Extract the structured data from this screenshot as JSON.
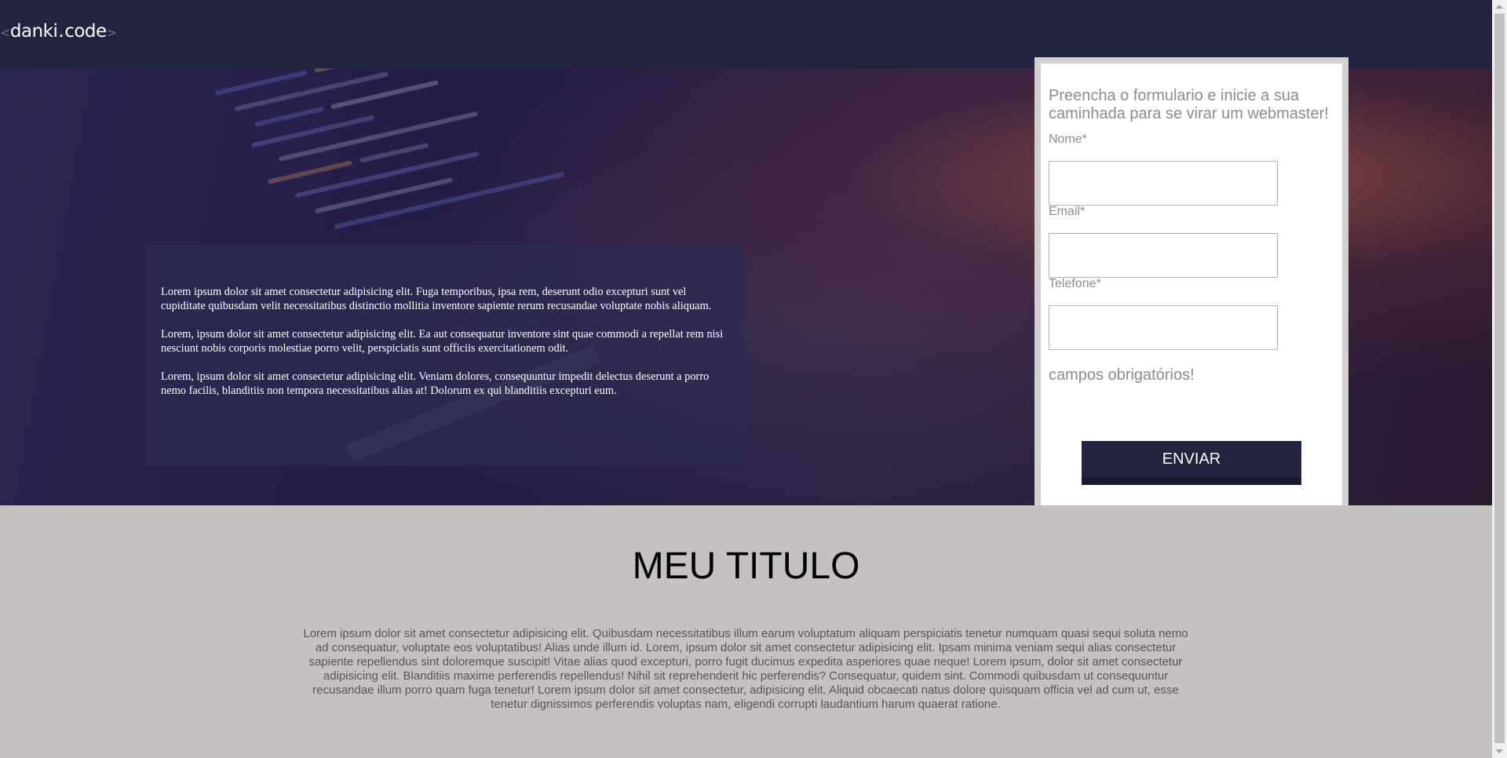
{
  "header": {
    "logo_open": "<",
    "logo_name": "danki",
    "logo_dot": ".",
    "logo_suffix": "code",
    "logo_close": ">"
  },
  "hero": {
    "paragraphs": [
      "Lorem ipsum dolor sit amet consectetur adipisicing elit. Fuga temporibus, ipsa rem, deserunt odio excepturi sunt vel cupiditate quibusdam velit necessitatibus distinctio mollitia inventore sapiente rerum recusandae voluptate nobis aliquam.",
      "Lorem, ipsum dolor sit amet consectetur adipisicing elit. Ea aut consequatur inventore sint quae commodi a repellat rem nisi nesciunt nobis corporis molestiae porro velit, perspiciatis sunt officiis exercitationem odit.",
      "Lorem, ipsum dolor sit amet consectetur adipisicing elit. Veniam dolores, consequuntur impedit delectus deserunt a porro nemo facilis, blanditiis non tempora necessitatibus alias at! Dolorum ex qui blanditiis excepturi eum."
    ]
  },
  "form": {
    "title": "Preencha o formulario e inicie a sua caminhada para se virar um webmaster!",
    "fields": [
      {
        "label": "Nome*",
        "value": ""
      },
      {
        "label": "Email*",
        "value": ""
      },
      {
        "label": "Telefone*",
        "value": ""
      }
    ],
    "required_note": "campos obrigatórios!",
    "submit_label": "ENVIAR"
  },
  "section": {
    "title": "MEU TITULO",
    "text": "Lorem ipsum dolor sit amet consectetur adipisicing elit. Quibusdam necessitatibus illum earum voluptatum aliquam perspiciatis tenetur numquam quasi sequi soluta nemo ad consequatur, voluptate eos voluptatibus! Alias unde illum id. Lorem, ipsum dolor sit amet consectetur adipisicing elit. Ipsam minima veniam sequi alias consectetur sapiente repellendus sint doloremque suscipit! Vitae alias quod excepturi, porro fugit ducimus expedita asperiores quae neque! Lorem ipsum, dolor sit amet consectetur adipisicing elit. Blanditiis maxime perferendis repellendus! Nihil sit reprehenderit hic perferendis? Consequatur, quidem sint. Commodi quibusdam ut consequuntur recusandae illum porro quam fuga tenetur! Lorem ipsum dolor sit amet consectetur, adipisicing elit. Aliquid obcaecati natus dolore quisquam officia vel ad cum ut, esse tenetur dignissimos perferendis voluptas nam, eligendi corrupti laudantium harum quaerat ratione."
  },
  "colors": {
    "header_bg": "#22243f",
    "section_bg": "#c6c1c1",
    "button_bg": "#22243f"
  }
}
